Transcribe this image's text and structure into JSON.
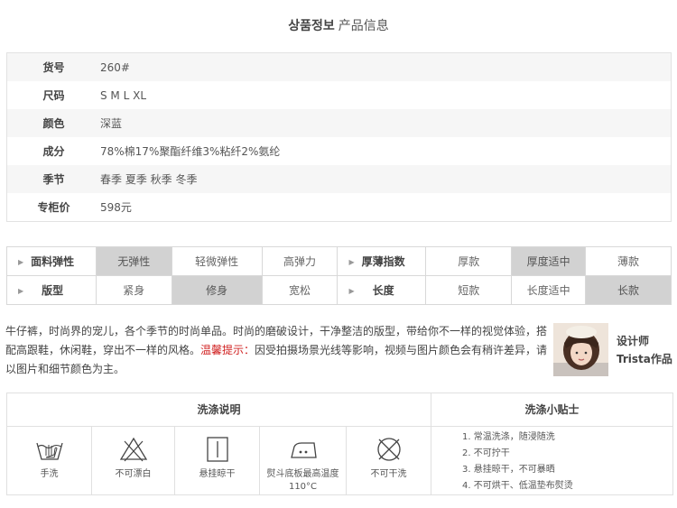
{
  "header": {
    "title_ko": "상품정보",
    "title_cn": "产品信息"
  },
  "specs": [
    {
      "label": "货号",
      "value": "260#"
    },
    {
      "label": "尺码",
      "value": "S  M  L  XL"
    },
    {
      "label": "颜色",
      "value": "深蓝"
    },
    {
      "label": "成分",
      "value": "78%棉17%聚酯纤维3%粘纤2%氨纶"
    },
    {
      "label": "季节",
      "value": "春季 夏季 秋季 冬季"
    },
    {
      "label": "专柜价",
      "value": "598元"
    }
  ],
  "attributes": {
    "elasticity": {
      "label": "面料弹性",
      "options": [
        "无弹性",
        "轻微弹性",
        "高弹力"
      ],
      "selected": "无弹性"
    },
    "thickness": {
      "label": "厚薄指数",
      "options": [
        "厚款",
        "厚度适中",
        "薄款"
      ],
      "selected": "厚度适中"
    },
    "fit": {
      "label": "版型",
      "options": [
        "紧身",
        "修身",
        "宽松"
      ],
      "selected": "修身"
    },
    "length": {
      "label": "长度",
      "options": [
        "短款",
        "长度适中",
        "长款"
      ],
      "selected": "长款"
    }
  },
  "description": {
    "text1": "牛仔裤，时尚界的宠儿，各个季节的时尚单品。时尚的磨破设计，干净整洁的版型，带给你不一样的视觉体验，搭配高跟鞋，休闲鞋，穿出不一样的风格。",
    "warning": "温馨提示：",
    "text2": "因受拍摄场景光线等影响，视频与图片颜色会有稍许差异，请以图片和细节颜色为主。"
  },
  "designer": {
    "line1": "设计师",
    "line2": "Trista作品"
  },
  "care": {
    "title": "洗涤说明",
    "icons": [
      {
        "icon": "hand-wash-icon",
        "caption": "手洗"
      },
      {
        "icon": "no-bleach-icon",
        "caption": "不可漂白"
      },
      {
        "icon": "hang-dry-icon",
        "caption": "悬挂晾干"
      },
      {
        "icon": "iron-medium-icon",
        "caption": "熨斗底板最高温度110°C"
      },
      {
        "icon": "no-dry-clean-icon",
        "caption": "不可干洗"
      }
    ]
  },
  "tips": {
    "title": "洗涤小贴士",
    "items": [
      "1. 常温洗涤，随浸随洗",
      "2. 不可拧干",
      "3. 悬挂晾干，不可暴晒",
      "4. 不可烘干、低温垫布熨烫"
    ]
  }
}
